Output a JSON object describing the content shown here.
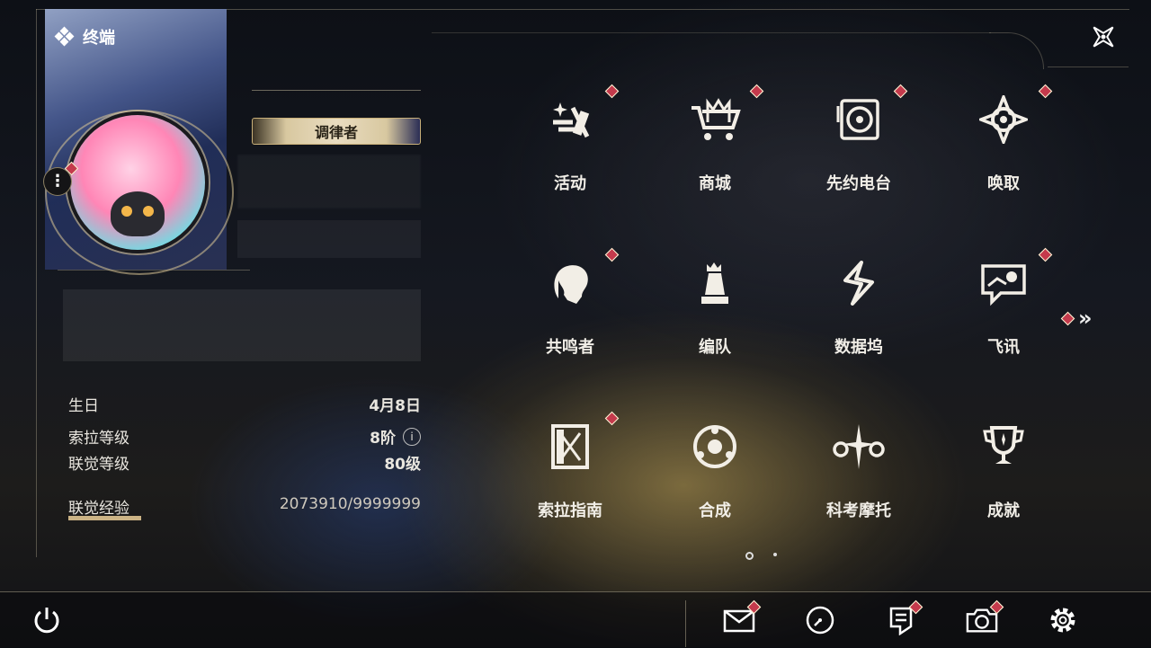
{
  "header": {
    "title": "终端"
  },
  "profile": {
    "title_badge": "调律者",
    "stats": [
      {
        "label": "生日",
        "value": "4月8日"
      },
      {
        "label": "索拉等级",
        "value": "8阶"
      },
      {
        "label": "联觉等级",
        "value": "80级"
      },
      {
        "label": "联觉经验",
        "value": "2073910/9999999"
      }
    ],
    "info_icon_text": "i",
    "more_icon_text": "⋮"
  },
  "menu": {
    "items": [
      {
        "label": "活动",
        "icon": "activity-icon",
        "badge": true
      },
      {
        "label": "商城",
        "icon": "shop-cart-icon",
        "badge": true
      },
      {
        "label": "先约电台",
        "icon": "radio-icon",
        "badge": true
      },
      {
        "label": "唤取",
        "icon": "convene-icon",
        "badge": true
      },
      {
        "label": "共鸣者",
        "icon": "resonator-icon",
        "badge": true
      },
      {
        "label": "编队",
        "icon": "team-icon",
        "badge": false
      },
      {
        "label": "数据坞",
        "icon": "data-bank-icon",
        "badge": false
      },
      {
        "label": "飞讯",
        "icon": "message-icon",
        "badge": true
      },
      {
        "label": "索拉指南",
        "icon": "guide-icon",
        "badge": true
      },
      {
        "label": "合成",
        "icon": "synthesis-icon",
        "badge": false
      },
      {
        "label": "科考摩托",
        "icon": "motorbike-icon",
        "badge": false
      },
      {
        "label": "成就",
        "icon": "trophy-icon",
        "badge": false
      }
    ],
    "next_arrow": "»",
    "pages": 2,
    "current_page": 1
  },
  "bottom_bar": {
    "icons": [
      "power-icon",
      "mail-icon",
      "clock-icon",
      "notice-icon",
      "camera-icon",
      "settings-icon"
    ]
  },
  "colors": {
    "accent_gold": "#cbb385",
    "badge_red": "#c43a4c"
  }
}
